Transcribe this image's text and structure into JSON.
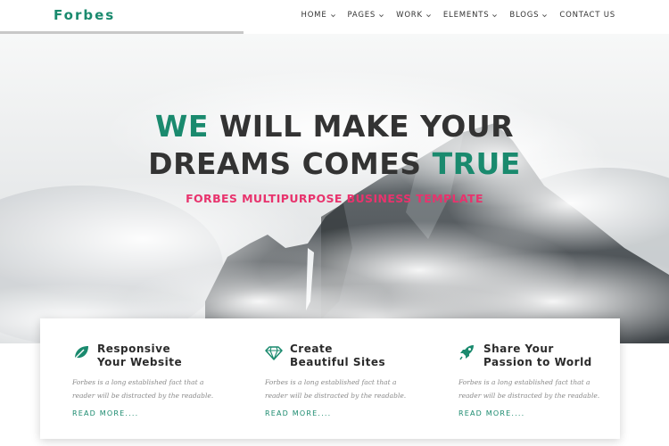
{
  "brand": {
    "name": "Forbes",
    "accent": "#1a8a6e",
    "pink": "#e8336d"
  },
  "nav": [
    {
      "label": "HOME",
      "dropdown": true
    },
    {
      "label": "PAGES",
      "dropdown": true
    },
    {
      "label": "WORK",
      "dropdown": true
    },
    {
      "label": "ELEMENTS",
      "dropdown": true
    },
    {
      "label": "BLOGS",
      "dropdown": true
    },
    {
      "label": "CONTACT US",
      "dropdown": false
    }
  ],
  "hero": {
    "line1_accent": "WE",
    "line1_rest": " WILL MAKE YOUR",
    "line2_rest": "DREAMS COMES ",
    "line2_accent": "TRUE",
    "subtitle": "FORBES MULTIPURPOSE BUSINESS TEMPLATE"
  },
  "features": [
    {
      "icon": "leaf-icon",
      "title_line1": "Responsive",
      "title_line2": "Your Website",
      "desc_line1": "Forbes is a long established fact that a",
      "desc_line2": "reader will be distracted by the readable.",
      "link": "READ MORE...."
    },
    {
      "icon": "diamond-icon",
      "title_line1": "Create",
      "title_line2": "Beautiful Sites",
      "desc_line1": "Forbes is a long established fact that a",
      "desc_line2": "reader will be distracted by the readable.",
      "link": "READ MORE...."
    },
    {
      "icon": "rocket-icon",
      "title_line1": "Share Your",
      "title_line2": "Passion to World",
      "desc_line1": "Forbes is a long established fact that a",
      "desc_line2": "reader will be distracted by the readable.",
      "link": "READ MORE...."
    }
  ]
}
